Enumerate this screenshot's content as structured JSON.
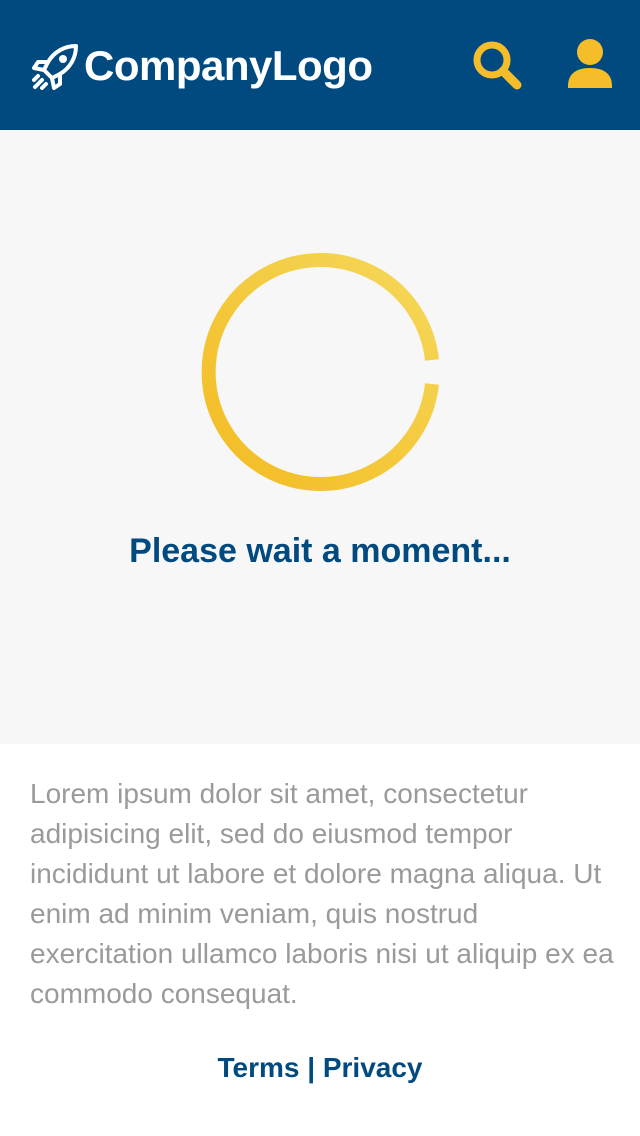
{
  "header": {
    "logo_text": "CompanyLogo",
    "background_color": "#004a80",
    "icons": {
      "logo": "rocket-icon",
      "search": "search-icon",
      "account": "user-icon"
    },
    "icon_color": "#f5bd2a"
  },
  "loader": {
    "message": "Please wait a moment...",
    "spinner_color": "#f5c22f",
    "panel_color": "#f7f7f7"
  },
  "content": {
    "paragraph": "Lorem ipsum dolor sit amet, consectetur adipisicing elit, sed do eiusmod tempor incididunt ut labore et dolore magna aliqua. Ut enim ad minim veniam, quis nostrud exercitation ullamco laboris nisi ut aliquip ex ea commodo consequat."
  },
  "footer": {
    "terms_label": "Terms",
    "separator": " | ",
    "privacy_label": "Privacy",
    "link_color": "#004a80"
  }
}
